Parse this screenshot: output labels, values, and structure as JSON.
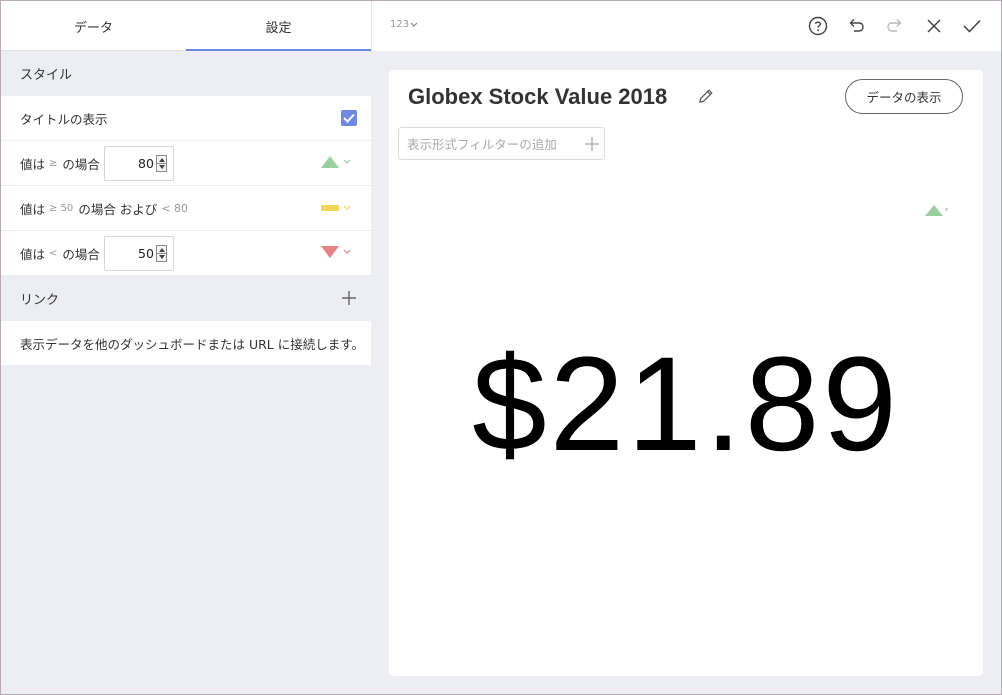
{
  "tabs": [
    {
      "label": "データ",
      "active": false
    },
    {
      "label": "設定",
      "active": true
    }
  ],
  "style_section": {
    "title": "スタイル"
  },
  "show_title": {
    "label": "タイトルの表示",
    "checked": true
  },
  "rule_high": {
    "prefix": "値は",
    "operator": "≥",
    "suffix": "の場合",
    "value": "80",
    "indicator": "green-up-triangle"
  },
  "rule_mid": {
    "prefix": "値は",
    "operator1": "≥ 50",
    "middle": "の場合 および",
    "operator2": "< 80",
    "indicator": "yellow-bar"
  },
  "rule_low": {
    "prefix": "値は",
    "operator": "<",
    "suffix": "の場合",
    "value": "50",
    "indicator": "red-down-triangle"
  },
  "link_section": {
    "title": "リンク",
    "description": "表示データを他のダッシュボードまたは URL に接続します。"
  },
  "toolbar": {
    "format_label": "123"
  },
  "card": {
    "title": "Globex Stock Value 2018",
    "data_button": "データの表示",
    "filter_placeholder": "表示形式フィルターの追加",
    "value": "$21.89"
  },
  "colors": {
    "accent": "#6e88e6",
    "up": "#99d19e",
    "mid": "#f5d557",
    "down": "#e88282"
  }
}
